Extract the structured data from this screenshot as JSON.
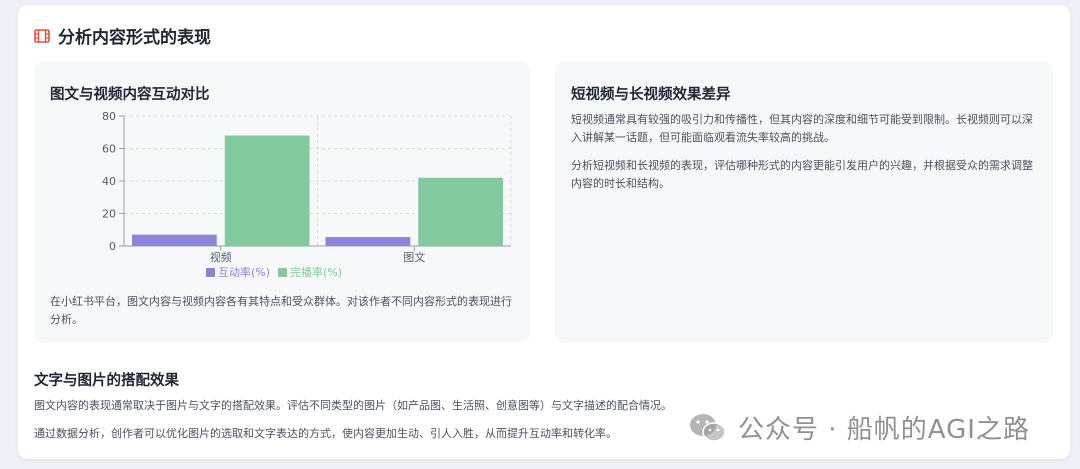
{
  "section": {
    "title": "分析内容形式的表现",
    "icon": "film-icon"
  },
  "chart_panel": {
    "title": "图文与视频内容互动对比",
    "description": "在小红书平台，图文内容与视频内容各有其特点和受众群体。对该作者不同内容形式的表现进行分析。"
  },
  "chart_data": {
    "type": "bar",
    "categories": [
      "视频",
      "图文"
    ],
    "series": [
      {
        "name": "互动率(%)",
        "values": [
          7,
          5.5
        ],
        "color": "#8b84d7"
      },
      {
        "name": "完播率(%)",
        "values": [
          68,
          42
        ],
        "color": "#82ca9d"
      }
    ],
    "ylim": [
      0,
      80
    ],
    "yticks": [
      0,
      20,
      40,
      60,
      80
    ],
    "grid": true,
    "legend": "bottom"
  },
  "right_panel": {
    "title": "短视频与长视频效果差异",
    "paragraphs": [
      "短视频通常具有较强的吸引力和传播性，但其内容的深度和细节可能受到限制。长视频则可以深入讲解某一话题，但可能面临观看流失率较高的挑战。",
      "分析短视频和长视频的表现，评估哪种形式的内容更能引发用户的兴趣，并根据受众的需求调整内容的时长和结构。"
    ]
  },
  "bottom": {
    "title": "文字与图片的搭配效果",
    "paragraphs": [
      "图文内容的表现通常取决于图片与文字的搭配效果。评估不同类型的图片（如产品图、生活照、创意图等）与文字描述的配合情况。",
      "通过数据分析，创作者可以优化图片的选取和文字表达的方式，使内容更加生动、引人入胜，从而提升互动率和转化率。"
    ]
  },
  "watermark": {
    "text": "公众号 · 船帆的AGI之路",
    "icon": "wechat-icon"
  },
  "colors": {
    "accent": "#e0523f"
  }
}
